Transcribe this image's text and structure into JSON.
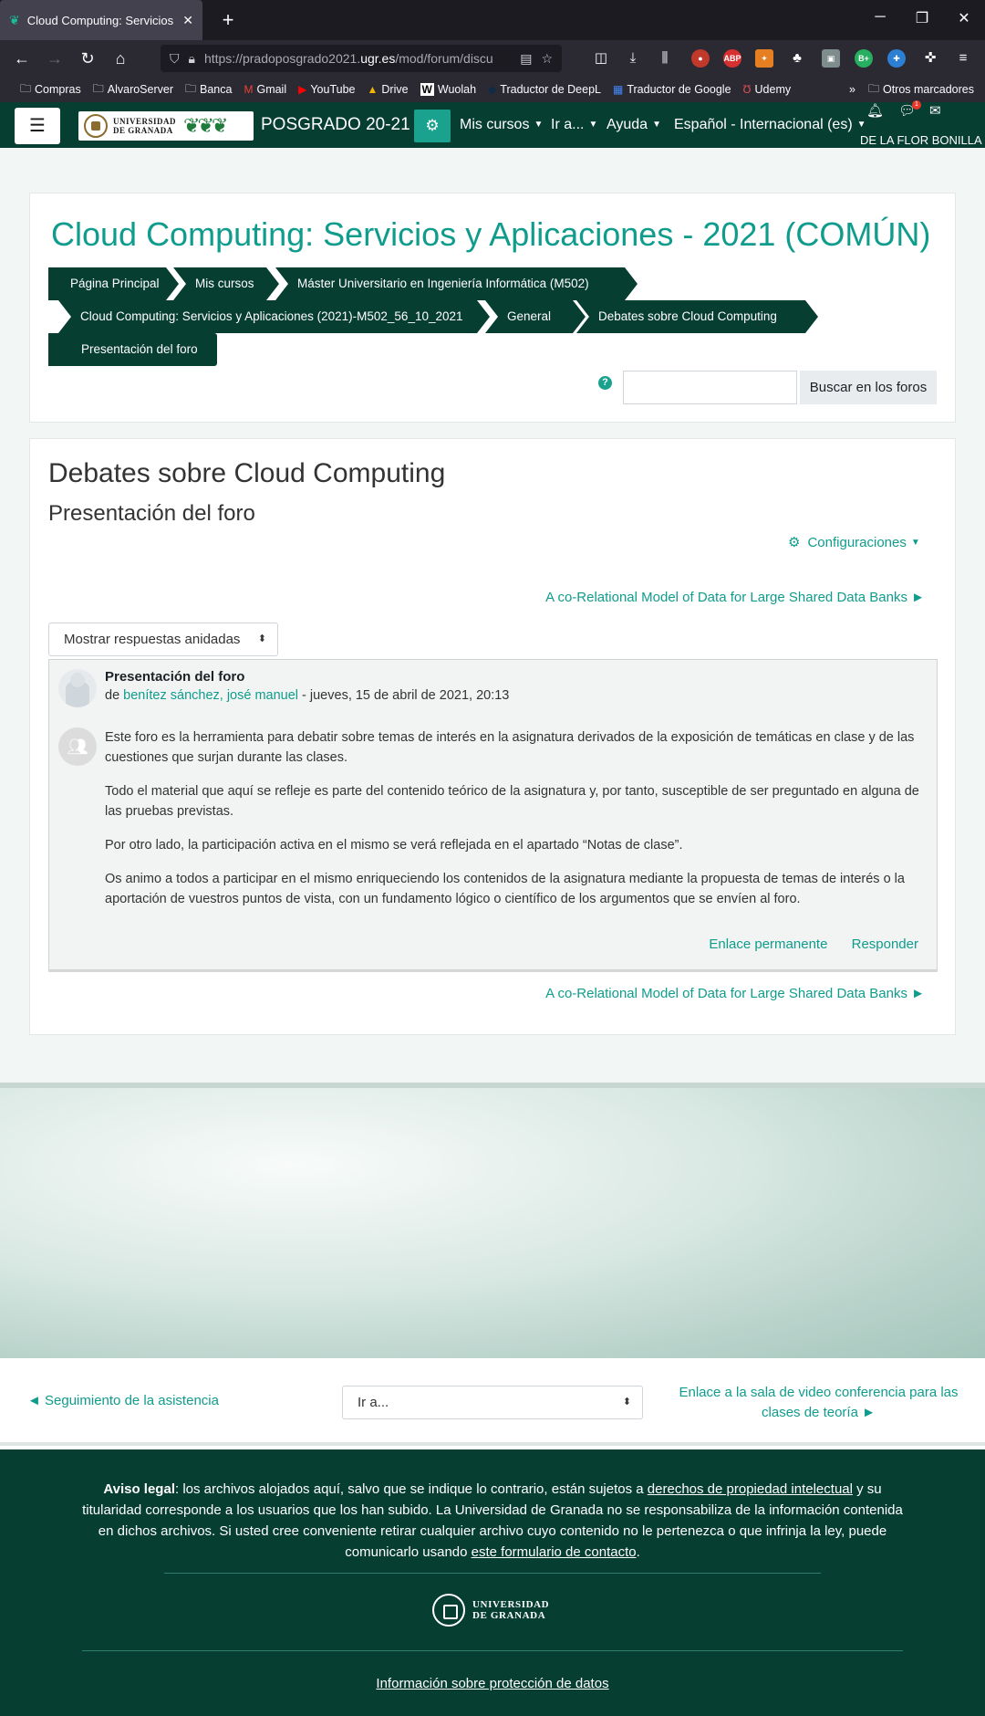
{
  "browser": {
    "tab_title": "Cloud Computing: Servicios y A",
    "url_prefix": "https://pradoposgrado2021.",
    "url_domain": "ugr.es",
    "url_path": "/mod/forum/discu",
    "bookmarks": [
      "Compras",
      "AlvaroServer",
      "Banca",
      "Gmail",
      "YouTube",
      "Drive",
      "Wuolah",
      "Traductor de DeepL",
      "Traductor de Google",
      "Udemy"
    ],
    "other_bookmarks": "Otros marcadores",
    "ext_abp": "ABP",
    "ext_bplus": "B+"
  },
  "moodle_nav": {
    "logo_line1": "UNIVERSIDAD",
    "logo_line2": "DE GRANADA",
    "brand": "POSGRADO 20-21",
    "menu": [
      "Mis cursos",
      "Ir a...",
      "Ayuda",
      "Español - Internacional (es)"
    ],
    "notification_count": "1",
    "username": "DE LA FLOR BONILLA"
  },
  "course": {
    "title": "Cloud Computing: Servicios y Aplicaciones - 2021 (COMÚN)",
    "breadcrumb": [
      "Página Principal",
      "Mis cursos",
      "Máster Universitario en Ingeniería Informática (M502)",
      "Cloud Computing: Servicios y Aplicaciones (2021)-M502_56_10_2021",
      "General",
      "Debates sobre Cloud Computing",
      "Presentación del foro"
    ],
    "search_value": "",
    "search_button": "Buscar en los foros"
  },
  "forum": {
    "heading": "Debates sobre Cloud Computing",
    "subheading": "Presentación del foro",
    "settings_label": "Configuraciones",
    "next_discussion": "A co-Relational Model of Data for Large Shared Data Banks ►",
    "display_mode": "Mostrar respuestas anidadas",
    "post": {
      "title": "Presentación del foro",
      "by_prefix": "de ",
      "author": "benítez sánchez, josé manuel",
      "date": " - jueves, 15 de abril de 2021, 20:13",
      "paragraphs": [
        "Este foro es la herramienta para debatir sobre temas de interés en la asignatura derivados de la exposición de temáticas en clase y de las cuestiones que surjan durante las clases.",
        "Todo el material que aquí se refleje es parte del contenido teórico de la asignatura y, por tanto, susceptible de ser preguntado en alguna de las pruebas previstas.",
        "Por otro lado, la participación activa en el mismo se verá reflejada en el apartado “Notas de clase”.",
        "Os animo a todos a participar en el mismo enriqueciendo los contenidos de la asignatura mediante la propuesta de temas de interés o la aportación de vuestros puntos de vista, con un fundamento lógico o científico de los argumentos que se envíen al foro."
      ],
      "permalink": "Enlace permanente",
      "reply": "Responder"
    }
  },
  "activity_nav": {
    "previous": "◄ Seguimiento de la asistencia",
    "jump_label": "Ir a...",
    "next": "Enlace a la sala de video conferencia para las clases de teoría ►"
  },
  "footer": {
    "legal_bold": "Aviso legal",
    "legal_1": ": los archivos alojados aquí, salvo que se indique lo contrario, están sujetos a ",
    "legal_link1": "derechos de propiedad intelectual",
    "legal_2": " y su titularidad corresponde a los usuarios que los han subido. La Universidad de Granada no se responsabiliza de la información contenida en dichos archivos. Si usted cree conveniente retirar cualquier archivo cuyo contenido no le pertenezca o que infrinja la ley, puede comunicarlo usando ",
    "legal_link2": "este formulario de contacto",
    "legal_3": ".",
    "logo_line1": "UNIVERSIDAD",
    "logo_line2": "DE GRANADA",
    "privacy": "Información sobre protección de datos"
  },
  "colors": {
    "brand_dark": "#073e32",
    "accent": "#0f9c8c",
    "accent_button": "#1aa28f"
  }
}
